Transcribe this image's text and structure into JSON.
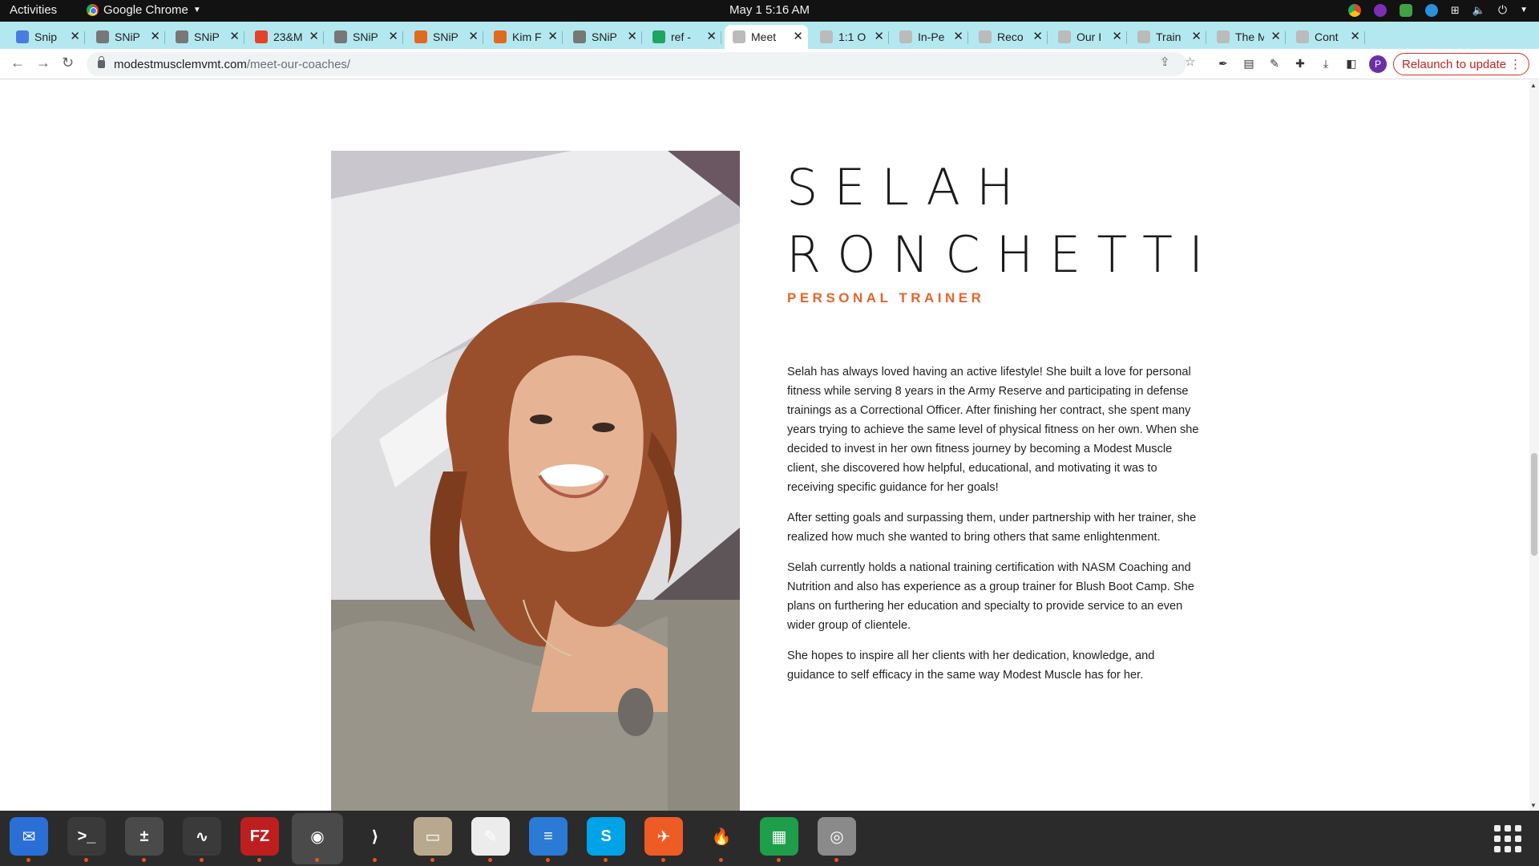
{
  "system": {
    "activities": "Activities",
    "app_name": "Google Chrome",
    "clock": "May 1  5:16 AM"
  },
  "tabs": [
    {
      "label": "Snip",
      "icon": "docs-icon",
      "color": "#4a7ce0"
    },
    {
      "label": "SNiP",
      "icon": "snip-icon",
      "color": "#777777"
    },
    {
      "label": "SNiP",
      "icon": "snip-icon",
      "color": "#777777"
    },
    {
      "label": "23&M",
      "icon": "gitlab-icon",
      "color": "#e24329"
    },
    {
      "label": "SNiP",
      "icon": "snip-icon",
      "color": "#777777"
    },
    {
      "label": "SNiP",
      "icon": "chat-icon",
      "color": "#e06b1e"
    },
    {
      "label": "Kim F",
      "icon": "chat-icon",
      "color": "#e06b1e"
    },
    {
      "label": "SNiP",
      "icon": "snip-icon",
      "color": "#777777"
    },
    {
      "label": "ref -",
      "icon": "sheets-icon",
      "color": "#1fa463"
    },
    {
      "label": "Meet",
      "icon": "site-icon",
      "color": "#bbbbbb",
      "active": true
    },
    {
      "label": "1:1 O",
      "icon": "globe-icon",
      "color": "#bbbbbb"
    },
    {
      "label": "In-Pe",
      "icon": "globe-icon",
      "color": "#bbbbbb"
    },
    {
      "label": "Reco",
      "icon": "globe-icon",
      "color": "#bbbbbb"
    },
    {
      "label": "Our I",
      "icon": "globe-icon",
      "color": "#bbbbbb"
    },
    {
      "label": "Train",
      "icon": "globe-icon",
      "color": "#bbbbbb"
    },
    {
      "label": "The M",
      "icon": "globe-icon",
      "color": "#bbbbbb"
    },
    {
      "label": "Cont",
      "icon": "globe-icon",
      "color": "#bbbbbb"
    }
  ],
  "omnibox": {
    "host": "modestmusclemvmt.com",
    "path": "/meet-our-coaches/"
  },
  "relaunch_label": "Relaunch to update",
  "profile_initial": "P",
  "coach": {
    "first_name": "SELAH",
    "last_name": "RONCHETTI",
    "role": "PERSONAL TRAINER",
    "bio": [
      "Selah has always loved having an active lifestyle! She built a love for personal fitness while serving 8 years in the Army Reserve and participating in defense trainings as a Correctional Officer. After finishing her contract, she spent many years trying to achieve the same level of physical fitness on her own. When she decided to invest in her own fitness journey by becoming a Modest Muscle client, she discovered how helpful, educational, and motivating it was to receiving specific guidance for her goals!",
      "After setting goals and surpassing them, under partnership with her trainer, she realized how much she wanted to bring others that same enlightenment.",
      "Selah currently holds a national training certification with NASM Coaching and Nutrition and also has experience as a group trainer for Blush Boot Camp. She plans on furthering her education and specialty to provide service to an even wider group of clientele.",
      "She hopes to inspire all her clients with her dedication, knowledge, and guidance to self efficacy in the same way Modest Muscle has for her."
    ],
    "accent_color": "#e8632a"
  },
  "dock": [
    {
      "name": "thunderbird-icon",
      "bg": "#2a6fd6",
      "glyph": "✉"
    },
    {
      "name": "terminal-icon",
      "bg": "#3a3a3a",
      "glyph": ">_"
    },
    {
      "name": "calculator-icon",
      "bg": "#4a4a4a",
      "glyph": "±"
    },
    {
      "name": "system-monitor-icon",
      "bg": "#3a3a3a",
      "glyph": "∿"
    },
    {
      "name": "filezilla-icon",
      "bg": "#bf1e1e",
      "glyph": "FZ"
    },
    {
      "name": "chrome-icon",
      "bg": "#4a4a4a",
      "glyph": "◉"
    },
    {
      "name": "vscode-icon",
      "bg": "#2b2b2b",
      "glyph": "⟩"
    },
    {
      "name": "files-icon",
      "bg": "#b8a98e",
      "glyph": "▭"
    },
    {
      "name": "text-editor-icon",
      "bg": "#ececec",
      "glyph": "✎"
    },
    {
      "name": "writer-icon",
      "bg": "#2a7ad6",
      "glyph": "≡"
    },
    {
      "name": "skype-icon",
      "bg": "#00a3e8",
      "glyph": "S"
    },
    {
      "name": "postman-icon",
      "bg": "#ef5b25",
      "glyph": "✈"
    },
    {
      "name": "burner-icon",
      "bg": "#2b2b2b",
      "glyph": "🔥"
    },
    {
      "name": "calc-sheet-icon",
      "bg": "#1e9e4a",
      "glyph": "▦"
    },
    {
      "name": "disc-icon",
      "bg": "#8a8a8a",
      "glyph": "◎"
    }
  ]
}
